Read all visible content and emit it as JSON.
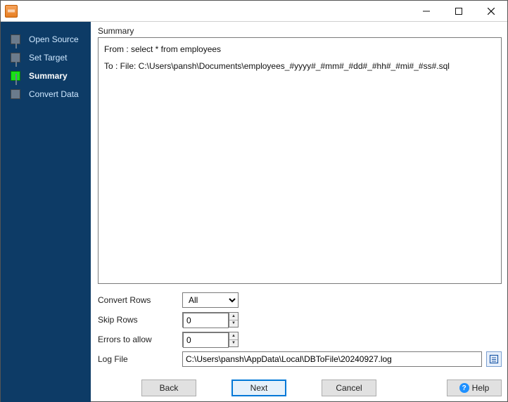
{
  "window": {
    "title": ""
  },
  "sidebar": {
    "steps": [
      {
        "label": "Open Source",
        "current": false
      },
      {
        "label": "Set Target",
        "current": false
      },
      {
        "label": "Summary",
        "current": true
      },
      {
        "label": "Convert Data",
        "current": false
      }
    ]
  },
  "summary": {
    "section_label": "Summary",
    "from_line": "From : select * from employees",
    "to_line": "To : File: C:\\Users\\pansh\\Documents\\employees_#yyyy#_#mm#_#dd#_#hh#_#mi#_#ss#.sql"
  },
  "form": {
    "convert_rows": {
      "label": "Convert Rows",
      "value": "All"
    },
    "skip_rows": {
      "label": "Skip Rows",
      "value": "0"
    },
    "errors_allow": {
      "label": "Errors to allow",
      "value": "0"
    },
    "log_file": {
      "label": "Log File",
      "value": "C:\\Users\\pansh\\AppData\\Local\\DBToFile\\20240927.log"
    }
  },
  "buttons": {
    "back": "Back",
    "next": "Next",
    "cancel": "Cancel",
    "help": "Help"
  }
}
